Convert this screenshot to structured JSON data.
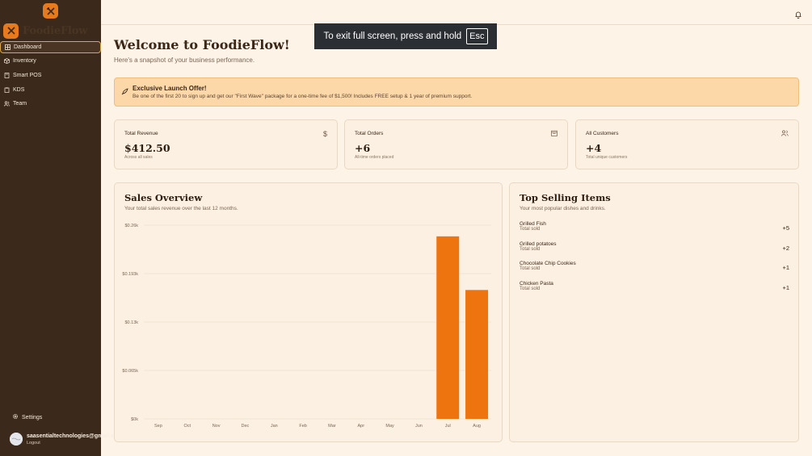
{
  "brand": {
    "name": "FoodieFlow"
  },
  "sidebar": {
    "items": [
      {
        "label": "Dashboard",
        "icon": "dashboard-icon",
        "active": true
      },
      {
        "label": "Inventory",
        "icon": "box-icon",
        "active": false
      },
      {
        "label": "Smart POS",
        "icon": "calculator-icon",
        "active": false
      },
      {
        "label": "KDS",
        "icon": "clipboard-icon",
        "active": false
      },
      {
        "label": "Team",
        "icon": "users-icon",
        "active": false
      }
    ],
    "settings_label": "Settings",
    "user": {
      "email": "saasentialtechnologies@gmail.com",
      "logout_label": "Logout"
    }
  },
  "fullscreen_notice": {
    "text": "To exit full screen, press and hold",
    "key": "Esc"
  },
  "header": {
    "title": "Welcome to FoodieFlow!",
    "subtitle": "Here's a snapshot of your business performance."
  },
  "promo": {
    "title": "Exclusive Launch Offer!",
    "text": "Be one of the first 20 to sign up and get our \"First Wave\" package for a one-time fee of $1,500! Includes FREE setup & 1 year of premium support."
  },
  "stats": [
    {
      "label": "Total Revenue",
      "value": "$412.50",
      "sub": "Across all sales",
      "icon": "dollar-icon"
    },
    {
      "label": "Total Orders",
      "value": "+6",
      "sub": "All-time orders placed",
      "icon": "calendar-icon"
    },
    {
      "label": "All Customers",
      "value": "+4",
      "sub": "Total unique customers",
      "icon": "users-icon"
    }
  ],
  "sales_overview": {
    "title": "Sales Overview",
    "subtitle": "Your total sales revenue over the last 12 months."
  },
  "chart_data": {
    "type": "bar",
    "categories": [
      "Sep",
      "Oct",
      "Nov",
      "Dec",
      "Jan",
      "Feb",
      "Mar",
      "Apr",
      "May",
      "Jun",
      "Jul",
      "Aug"
    ],
    "values": [
      0,
      0,
      0,
      0,
      0,
      0,
      0,
      0,
      0,
      0,
      245,
      173
    ],
    "yticks": [
      "$0k",
      "$0.065k",
      "$0.13k",
      "$0.193k",
      "$0.26k"
    ],
    "ylim": [
      0,
      260
    ],
    "bar_color": "#ee7410",
    "grid": true
  },
  "top_selling": {
    "title": "Top Selling Items",
    "subtitle": "Your most popular dishes and drinks.",
    "items": [
      {
        "name": "Grilled Fish",
        "sub": "Total sold",
        "count": "+5"
      },
      {
        "name": "Grilled potatoes",
        "sub": "Total sold",
        "count": "+2"
      },
      {
        "name": "Chocolate Chip Cookies",
        "sub": "Total sold",
        "count": "+1"
      },
      {
        "name": "Chicken Pasta",
        "sub": "Total sold",
        "count": "+1"
      }
    ]
  }
}
